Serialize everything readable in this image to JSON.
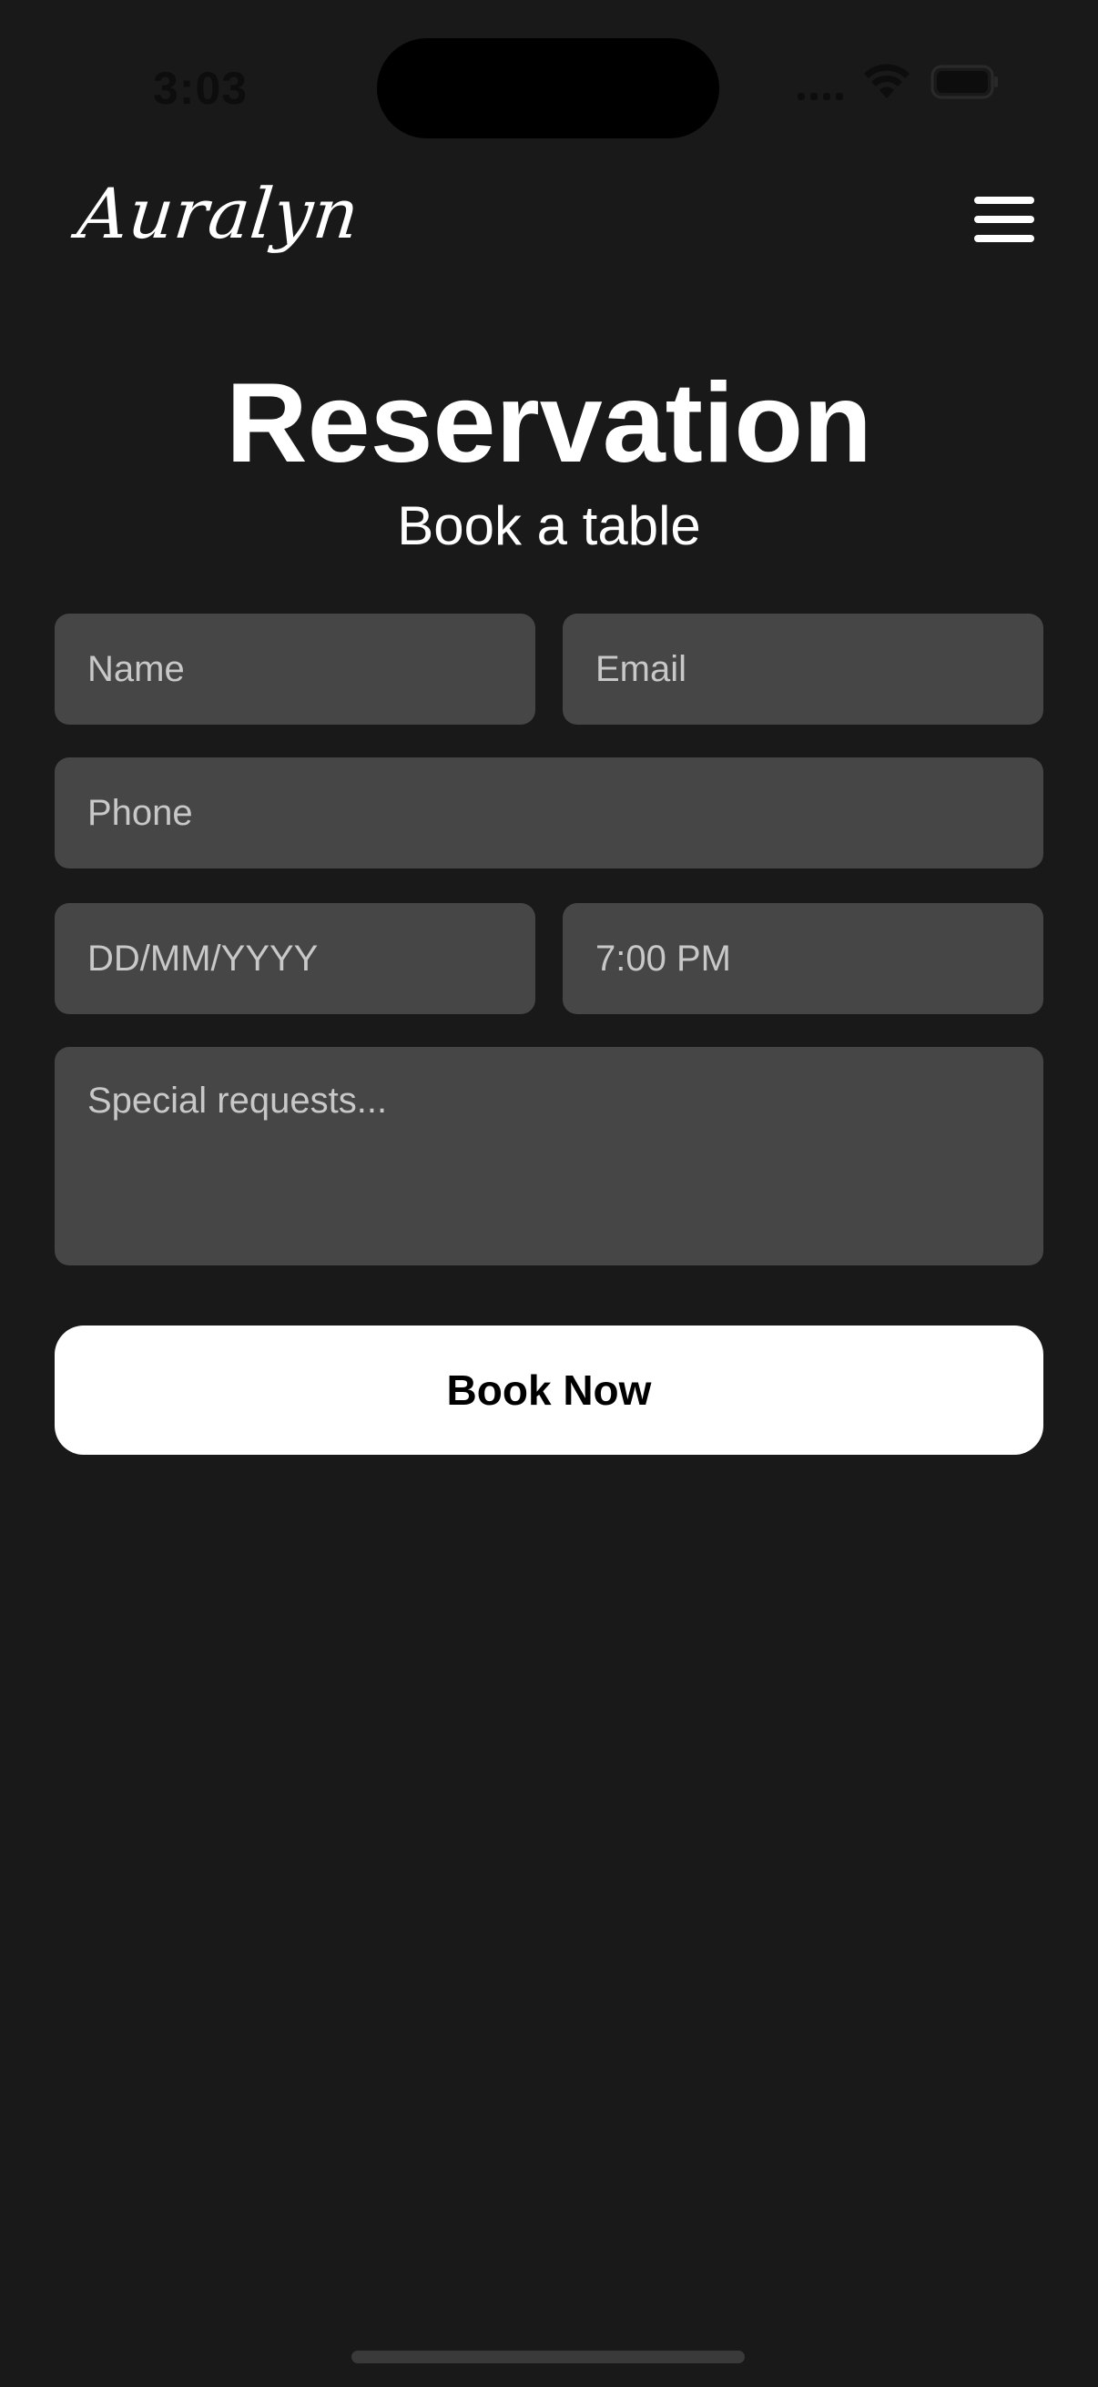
{
  "status_bar": {
    "time": "3:03"
  },
  "header": {
    "brand": "Auralyn",
    "menu_icon": "hamburger-menu-icon"
  },
  "main": {
    "title": "Reservation",
    "subtitle": "Book a table"
  },
  "form": {
    "name_placeholder": "Name",
    "email_placeholder": "Email",
    "phone_placeholder": "Phone",
    "date_placeholder": "DD/MM/YYYY",
    "time_value": "7:00 PM",
    "requests_placeholder": "Special requests...",
    "submit_label": "Book Now"
  },
  "colors": {
    "background": "#191919",
    "field": "#464646",
    "button": "#ffffff",
    "text": "#ffffff"
  }
}
